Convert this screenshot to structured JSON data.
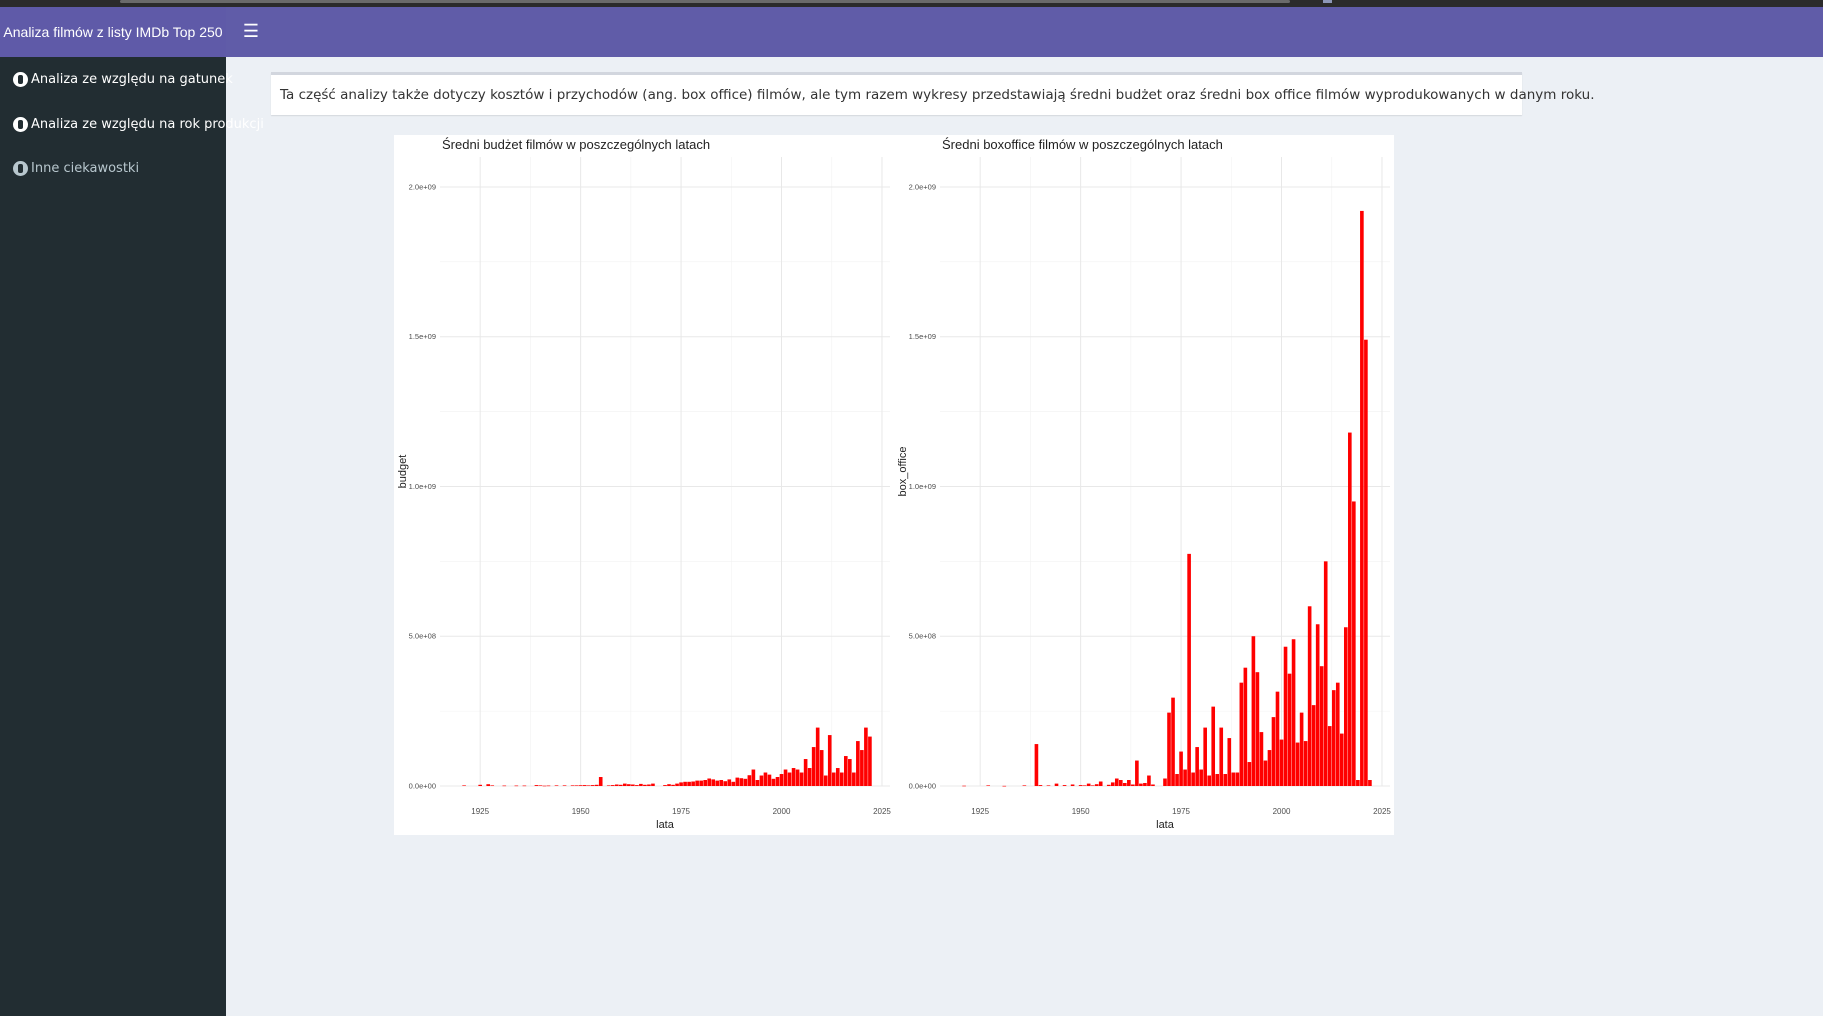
{
  "app": {
    "title": "Analiza filmów z listy IMDb Top 250",
    "menu_icon": "hamburger-icon"
  },
  "sidebar": {
    "items": [
      {
        "label": "Analiza ze względu na gatunek",
        "icon": "info-icon"
      },
      {
        "label": "Analiza ze względu na rok produkcji",
        "icon": "info-icon"
      },
      {
        "label": "Inne ciekawostki",
        "icon": "info-icon"
      }
    ]
  },
  "main": {
    "description": "Ta część analizy także dotyczy kosztów i przychodów (ang. box office) filmów, ale tym razem wykresy przedstawiają średni budżet oraz średni box office filmów wyprodukowanych w danym roku."
  },
  "colors": {
    "navbar": "#605ca8",
    "sidebar": "#222d32",
    "bar_fill": "#ff0000",
    "background": "#ecf0f5"
  },
  "chart_data": [
    {
      "type": "bar",
      "title": "Średni budżet filmów w poszczególnych latach",
      "xlabel": "lata",
      "ylabel": "budget",
      "xlim": [
        1915,
        2027
      ],
      "ylim": [
        0,
        2100000000
      ],
      "x_ticks": [
        1925,
        1950,
        1975,
        2000,
        2025
      ],
      "y_ticks": [
        {
          "value": 0,
          "label": "0.0e+00"
        },
        {
          "value": 500000000,
          "label": "5.0e+08"
        },
        {
          "value": 1000000000,
          "label": "1.0e+09"
        },
        {
          "value": 1500000000,
          "label": "1.5e+09"
        },
        {
          "value": 2000000000,
          "label": "2.0e+09"
        }
      ],
      "x": [
        1921,
        1925,
        1927,
        1928,
        1931,
        1934,
        1936,
        1939,
        1940,
        1941,
        1942,
        1944,
        1946,
        1948,
        1949,
        1950,
        1951,
        1952,
        1953,
        1954,
        1955,
        1957,
        1958,
        1959,
        1960,
        1961,
        1962,
        1963,
        1964,
        1965,
        1966,
        1967,
        1968,
        1971,
        1972,
        1973,
        1974,
        1975,
        1976,
        1977,
        1978,
        1979,
        1980,
        1981,
        1982,
        1983,
        1984,
        1985,
        1986,
        1987,
        1988,
        1989,
        1990,
        1991,
        1992,
        1993,
        1994,
        1995,
        1996,
        1997,
        1998,
        1999,
        2000,
        2001,
        2002,
        2003,
        2004,
        2005,
        2006,
        2007,
        2008,
        2009,
        2010,
        2011,
        2012,
        2013,
        2014,
        2015,
        2016,
        2017,
        2018,
        2019,
        2020,
        2021,
        2022
      ],
      "values": [
        2000000,
        4000000,
        6000000,
        2000000,
        1500000,
        1500000,
        1500000,
        3000000,
        2000000,
        1000000,
        1500000,
        2000000,
        2000000,
        2000000,
        2000000,
        2500000,
        3000000,
        2000000,
        3000000,
        4000000,
        30000000,
        2000000,
        3000000,
        5000000,
        4000000,
        8000000,
        6000000,
        5000000,
        3000000,
        7000000,
        4000000,
        5000000,
        8000000,
        3000000,
        6000000,
        4000000,
        8000000,
        12000000,
        14000000,
        14000000,
        15000000,
        18000000,
        18000000,
        20000000,
        25000000,
        22000000,
        18000000,
        20000000,
        16000000,
        22000000,
        14000000,
        28000000,
        26000000,
        24000000,
        36000000,
        55000000,
        20000000,
        35000000,
        45000000,
        38000000,
        24000000,
        30000000,
        40000000,
        55000000,
        45000000,
        60000000,
        55000000,
        45000000,
        90000000,
        60000000,
        130000000,
        195000000,
        120000000,
        35000000,
        170000000,
        45000000,
        60000000,
        45000000,
        100000000,
        90000000,
        45000000,
        150000000,
        120000000,
        195000000,
        165000000
      ]
    },
    {
      "type": "bar",
      "title": "Średni boxoffice  filmów w poszczególnych latach",
      "xlabel": "lata",
      "ylabel": "box_office",
      "xlim": [
        1915,
        2027
      ],
      "ylim": [
        0,
        2100000000
      ],
      "x_ticks": [
        1925,
        1950,
        1975,
        2000,
        2025
      ],
      "y_ticks": [
        {
          "value": 0,
          "label": "0.0e+00"
        },
        {
          "value": 500000000,
          "label": "5.0e+08"
        },
        {
          "value": 1000000000,
          "label": "1.0e+09"
        },
        {
          "value": 1500000000,
          "label": "1.5e+09"
        },
        {
          "value": 2000000000,
          "label": "2.0e+09"
        }
      ],
      "x": [
        1921,
        1927,
        1931,
        1936,
        1939,
        1940,
        1942,
        1944,
        1946,
        1948,
        1950,
        1951,
        1952,
        1953,
        1954,
        1955,
        1957,
        1958,
        1959,
        1960,
        1961,
        1962,
        1963,
        1964,
        1965,
        1966,
        1967,
        1968,
        1971,
        1972,
        1973,
        1974,
        1975,
        1976,
        1977,
        1978,
        1979,
        1980,
        1981,
        1982,
        1983,
        1984,
        1985,
        1986,
        1987,
        1988,
        1989,
        1990,
        1991,
        1992,
        1993,
        1994,
        1995,
        1996,
        1997,
        1998,
        1999,
        2000,
        2001,
        2002,
        2003,
        2004,
        2005,
        2006,
        2007,
        2008,
        2009,
        2010,
        2011,
        2012,
        2013,
        2014,
        2015,
        2016,
        2017,
        2018,
        2019,
        2020,
        2021,
        2022
      ],
      "values": [
        1000000,
        2000000,
        500000,
        2000000,
        140000000,
        3000000,
        2000000,
        8000000,
        3000000,
        5000000,
        3000000,
        2000000,
        8000000,
        2000000,
        6000000,
        15000000,
        4000000,
        12000000,
        25000000,
        20000000,
        10000000,
        20000000,
        5000000,
        85000000,
        8000000,
        10000000,
        35000000,
        5000000,
        25000000,
        245000000,
        295000000,
        40000000,
        115000000,
        55000000,
        775000000,
        45000000,
        130000000,
        55000000,
        195000000,
        35000000,
        265000000,
        40000000,
        195000000,
        40000000,
        160000000,
        45000000,
        45000000,
        345000000,
        395000000,
        80000000,
        500000000,
        380000000,
        180000000,
        85000000,
        120000000,
        230000000,
        315000000,
        155000000,
        465000000,
        375000000,
        490000000,
        145000000,
        245000000,
        150000000,
        600000000,
        270000000,
        540000000,
        400000000,
        750000000,
        200000000,
        320000000,
        345000000,
        175000000,
        530000000,
        1180000000,
        950000000,
        20000000,
        1920000000,
        1490000000,
        20000000
      ]
    }
  ]
}
